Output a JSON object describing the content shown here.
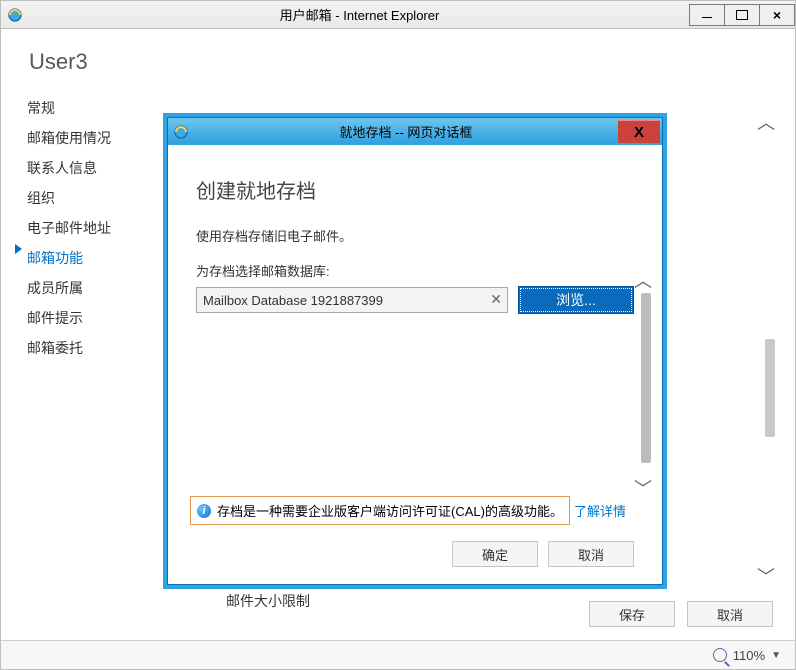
{
  "main_window": {
    "title": "用户邮箱 - Internet Explorer",
    "user": "User3",
    "nav": [
      "常规",
      "邮箱使用情况",
      "联系人信息",
      "组织",
      "电子邮件地址",
      "邮箱功能",
      "成员所属",
      "邮件提示",
      "邮箱委托"
    ],
    "nav_active_index": 5,
    "truncated_section": "邮件大小限制",
    "save_label": "保存",
    "cancel_label": "取消",
    "zoom_text": "110%"
  },
  "dialog": {
    "title": "就地存档 -- 网页对话框",
    "heading": "创建就地存档",
    "description": "使用存档存储旧电子邮件。",
    "db_label": "为存档选择邮箱数据库:",
    "db_value": "Mailbox Database 1921887399",
    "browse_label": "浏览...",
    "info_text": "存档是一种需要企业版客户端访问许可证(CAL)的高级功能。",
    "learn_more": "了解详情",
    "ok_label": "确定",
    "cancel_label": "取消"
  }
}
